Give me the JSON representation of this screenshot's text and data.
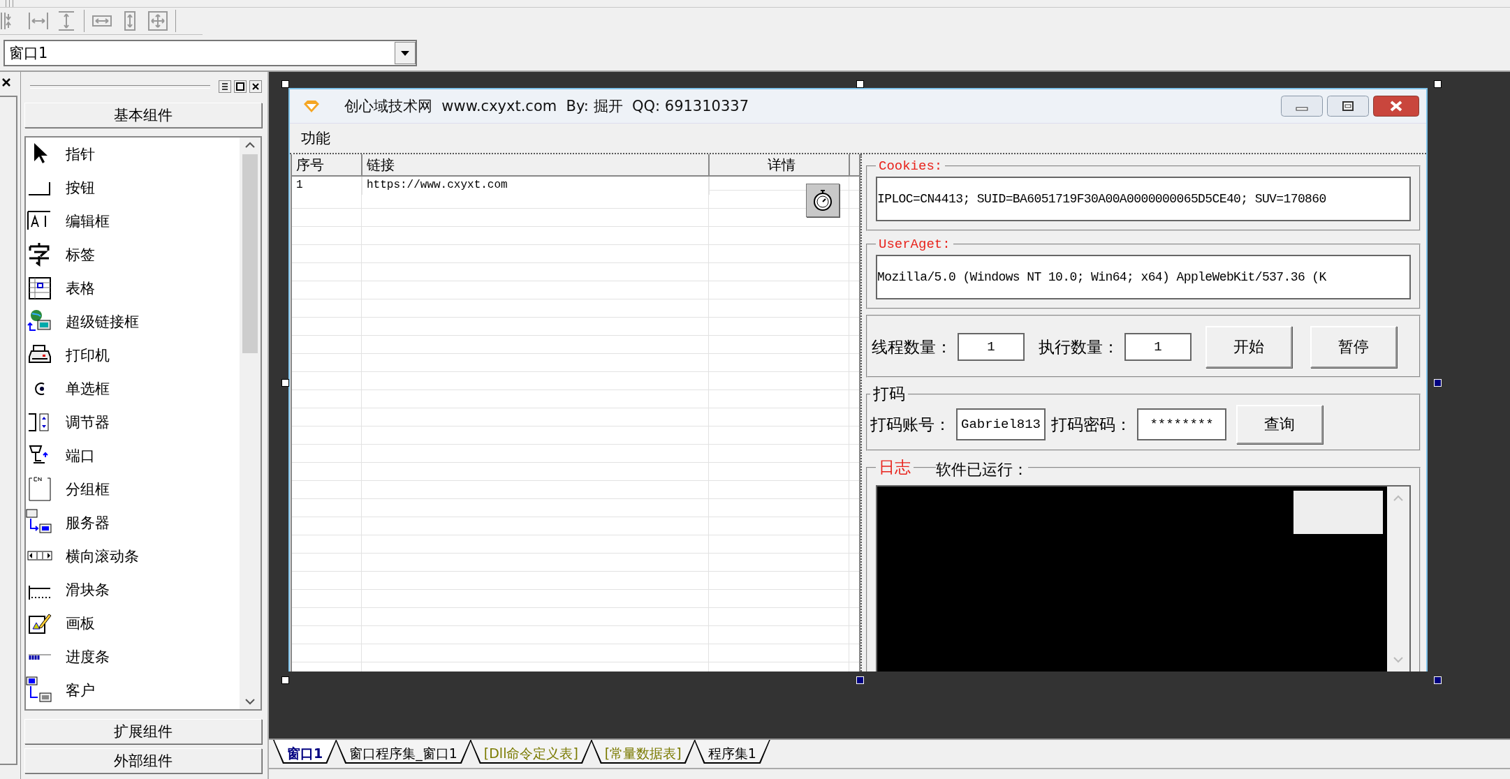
{
  "window_selector": {
    "value": "窗口1"
  },
  "palette": {
    "top_group": "基本组件",
    "items": [
      {
        "label": "指针"
      },
      {
        "label": "按钮"
      },
      {
        "label": "编辑框"
      },
      {
        "label": "标签"
      },
      {
        "label": "表格"
      },
      {
        "label": "超级链接框"
      },
      {
        "label": "打印机"
      },
      {
        "label": "单选框"
      },
      {
        "label": "调节器"
      },
      {
        "label": "端口"
      },
      {
        "label": "分组框"
      },
      {
        "label": "服务器"
      },
      {
        "label": "横向滚动条"
      },
      {
        "label": "滑块条"
      },
      {
        "label": "画板"
      },
      {
        "label": "进度条"
      },
      {
        "label": "客户"
      }
    ],
    "bottom_groups": [
      "扩展组件",
      "外部组件"
    ]
  },
  "form": {
    "title": "创心域技术网  www.cxyxt.com  By: 掘开  QQ: 691310337",
    "menu": [
      "功能"
    ],
    "table": {
      "columns": [
        "序号",
        "链接",
        "详情"
      ],
      "rows": [
        {
          "cells": [
            "1",
            "https://www.cxyxt.com"
          ]
        }
      ]
    },
    "cookies": {
      "label": "Cookies:",
      "value": "IPLOC=CN4413; SUID=BA6051719F30A00A0000000065D5CE40; SUV=170860"
    },
    "user_agent": {
      "label": "UserAget:",
      "value": "Mozilla/5.0 (Windows NT 10.0; Win64; x64) AppleWebKit/537.36 (K"
    },
    "threads": {
      "label": "线程数量：",
      "value": "1"
    },
    "executions": {
      "label": "执行数量：",
      "value": "1"
    },
    "run_buttons": [
      "开始",
      "暂停"
    ],
    "captcha": {
      "title": "打码",
      "account_label": "打码账号：",
      "account": "Gabriel813",
      "password_label": "打码密码：",
      "password": "********",
      "button": "查询"
    },
    "log": {
      "title": "日志",
      "status": "软件已运行："
    }
  },
  "tabs": [
    {
      "label": "窗口1",
      "kind": "window",
      "selected": true
    },
    {
      "label": "窗口程序集_窗口1",
      "kind": "module",
      "selected": false
    },
    {
      "label": "[Dll命令定义表]",
      "kind": "table",
      "selected": false
    },
    {
      "label": "[常量数据表]",
      "kind": "table",
      "selected": false
    },
    {
      "label": "程序集1",
      "kind": "module",
      "selected": false
    }
  ]
}
